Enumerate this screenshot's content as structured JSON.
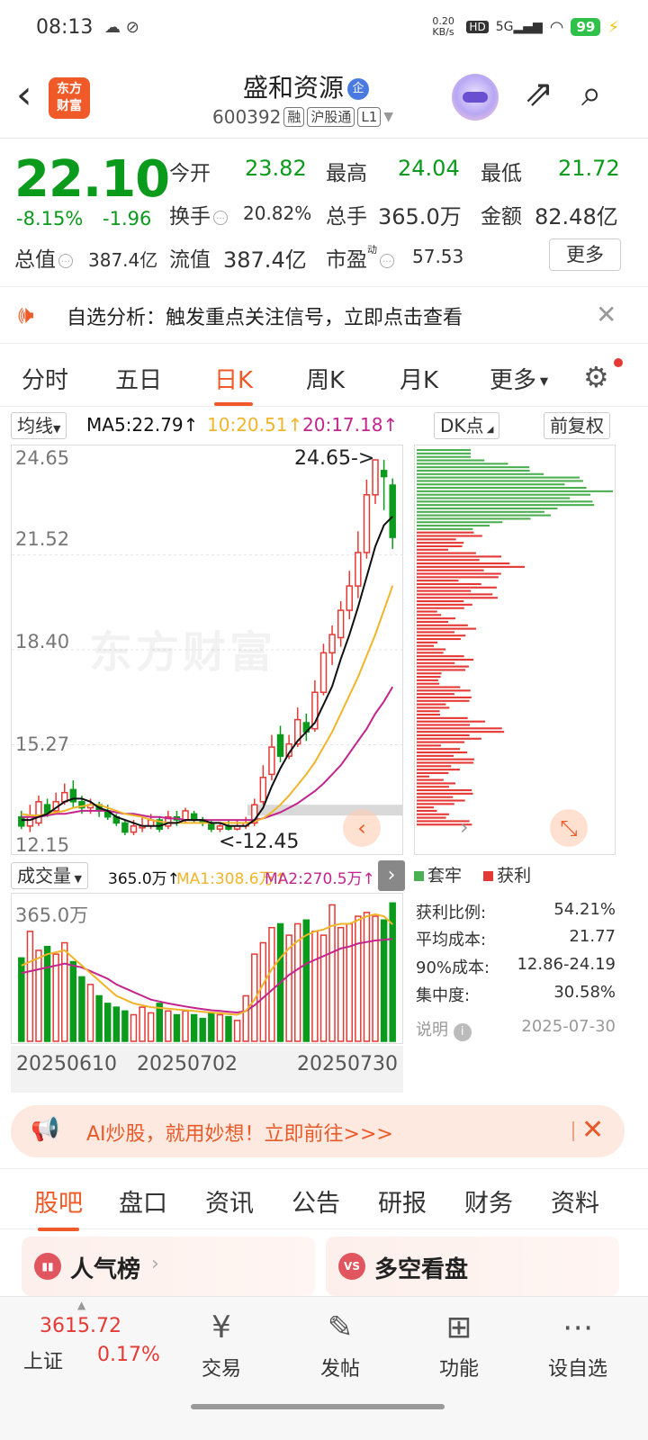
{
  "status_bar": {
    "time": "08:13",
    "net_speed": "0.20 KB/s",
    "net_type": "5G",
    "battery": "99"
  },
  "header": {
    "stock_name": "盛和资源",
    "enterprise_badge": "企",
    "code": "600392",
    "tags": [
      "融",
      "沪股通",
      "L1"
    ],
    "logo_text": "东方财富"
  },
  "quote": {
    "price": "22.10",
    "change_pct": "-8.15%",
    "change_abs": "-1.96",
    "open_label": "今开",
    "open": "23.82",
    "high_label": "最高",
    "high": "24.04",
    "low_label": "最低",
    "low": "21.72",
    "turnover_label": "换手",
    "turnover": "20.82%",
    "volume_label": "总手",
    "volume": "365.0万",
    "amount_label": "金额",
    "amount": "82.48亿",
    "total_mv_label": "总值",
    "total_mv": "387.4亿",
    "float_mv_label": "流值",
    "float_mv": "387.4亿",
    "pe_label": "市盈",
    "pe_sup": "动",
    "pe": "57.53",
    "more_button": "更多"
  },
  "alert": {
    "text": "自选分析：触发重点关注信号，立即点击查看"
  },
  "period_tabs": [
    "分时",
    "五日",
    "日K",
    "周K",
    "月K",
    "更多"
  ],
  "active_period": "日K",
  "ma_bar": {
    "dropdown": "均线",
    "ma5": "MA5:22.79",
    "ma10": "10:20.51",
    "ma20": "20:17.18",
    "dk_button": "DK点",
    "adjust_button": "前复权"
  },
  "kline": {
    "y_ticks": [
      "24.65",
      "21.52",
      "18.40",
      "15.27",
      "12.15"
    ],
    "high_marker": "24.65->",
    "low_marker": "<-12.45",
    "watermark": "东方财富"
  },
  "volume": {
    "dropdown": "成交量",
    "vol": "365.0万",
    "ma1": "MA1:308.6万",
    "ma2": "MA2:270.5万",
    "max_label": "365.0万",
    "x_labels": [
      "20250610",
      "20250702",
      "20250730"
    ]
  },
  "dk_panel": {
    "legend_trapped": "套牢",
    "legend_profit": "获利",
    "stats": [
      {
        "label": "获利比例:",
        "value": "54.21%"
      },
      {
        "label": "平均成本:",
        "value": "21.77"
      },
      {
        "label": "90%成本:",
        "value": "12.86-24.19"
      },
      {
        "label": "集中度:",
        "value": "30.58%"
      }
    ],
    "note_label": "说明",
    "date": "2025-07-30"
  },
  "promo": {
    "text": "AI炒股，就用妙想！立即前往>>>"
  },
  "content_tabs": [
    "股吧",
    "盘口",
    "资讯",
    "公告",
    "研报",
    "财务",
    "资料"
  ],
  "active_content_tab": "股吧",
  "cards": [
    {
      "icon": "bar-chart-icon",
      "title": "人气榜"
    },
    {
      "icon": "vs-icon",
      "title": "多空看盘"
    }
  ],
  "bottom_nav": {
    "index_value": "3615.72",
    "index_name": "上证",
    "index_pct": "0.17%",
    "items": [
      "交易",
      "发帖",
      "功能",
      "设自选"
    ]
  },
  "colors": {
    "up": "#e53935",
    "down": "#0a9a1c",
    "accent": "#f05a28",
    "ma5": "#111111",
    "ma10": "#f0b52a",
    "ma20": "#c2258d"
  },
  "chart_data": {
    "type": "candlestick",
    "ylim": [
      12.15,
      24.65
    ],
    "candles": [
      [
        12.9,
        12.6,
        13.1,
        12.5
      ],
      [
        12.6,
        12.9,
        13.3,
        12.4
      ],
      [
        12.7,
        13.4,
        13.6,
        12.6
      ],
      [
        13.3,
        13.0,
        13.5,
        12.9
      ],
      [
        13.1,
        13.4,
        13.7,
        13.0
      ],
      [
        13.4,
        13.7,
        14.0,
        13.3
      ],
      [
        13.8,
        13.4,
        14.1,
        13.2
      ],
      [
        13.4,
        13.2,
        13.6,
        13.0
      ],
      [
        13.2,
        13.3,
        13.5,
        13.0
      ],
      [
        13.3,
        13.1,
        13.4,
        12.9
      ],
      [
        13.1,
        12.9,
        13.3,
        12.8
      ],
      [
        12.9,
        12.7,
        13.0,
        12.6
      ],
      [
        12.7,
        12.4,
        12.8,
        12.3
      ],
      [
        12.4,
        12.6,
        12.8,
        12.3
      ],
      [
        12.6,
        12.6,
        12.9,
        12.4
      ],
      [
        12.6,
        12.8,
        13.0,
        12.5
      ],
      [
        12.8,
        12.5,
        12.9,
        12.4
      ],
      [
        12.6,
        12.9,
        13.1,
        12.5
      ],
      [
        12.9,
        12.8,
        13.1,
        12.6
      ],
      [
        12.8,
        13.1,
        13.2,
        12.7
      ],
      [
        13.0,
        12.8,
        13.1,
        12.7
      ],
      [
        12.8,
        12.7,
        12.9,
        12.6
      ],
      [
        12.7,
        12.5,
        12.8,
        12.4
      ],
      [
        12.5,
        12.6,
        12.7,
        12.4
      ],
      [
        12.6,
        12.5,
        12.8,
        12.45
      ],
      [
        12.5,
        12.6,
        12.8,
        12.45
      ],
      [
        12.6,
        12.7,
        12.9,
        12.5
      ],
      [
        12.7,
        13.3,
        13.5,
        12.6
      ],
      [
        13.4,
        14.2,
        14.6,
        13.3
      ],
      [
        14.3,
        15.2,
        15.6,
        14.1
      ],
      [
        15.6,
        14.9,
        15.9,
        14.7
      ],
      [
        14.9,
        15.3,
        15.6,
        14.8
      ],
      [
        15.3,
        16.1,
        16.5,
        15.2
      ],
      [
        16.0,
        15.7,
        16.3,
        15.4
      ],
      [
        15.8,
        17.0,
        17.4,
        15.7
      ],
      [
        17.0,
        18.3,
        18.6,
        16.9
      ],
      [
        18.3,
        18.9,
        19.2,
        17.9
      ],
      [
        18.8,
        19.7,
        20.0,
        18.5
      ],
      [
        19.7,
        20.5,
        21.0,
        19.4
      ],
      [
        20.5,
        21.6,
        22.3,
        20.1
      ],
      [
        21.6,
        23.5,
        24.0,
        21.4
      ],
      [
        23.5,
        24.65,
        24.65,
        23.2
      ],
      [
        24.3,
        24.1,
        24.65,
        23.0
      ],
      [
        23.82,
        22.1,
        24.04,
        21.72
      ]
    ],
    "ma5": [
      12.8,
      12.8,
      12.9,
      13.0,
      13.2,
      13.4,
      13.5,
      13.5,
      13.4,
      13.2,
      13.1,
      12.9,
      12.8,
      12.7,
      12.6,
      12.6,
      12.6,
      12.7,
      12.7,
      12.8,
      12.8,
      12.8,
      12.7,
      12.7,
      12.6,
      12.6,
      12.6,
      12.8,
      13.2,
      13.9,
      14.5,
      15.0,
      15.4,
      15.7,
      16.0,
      16.6,
      17.2,
      18.1,
      18.9,
      19.8,
      20.8,
      21.8,
      22.5,
      22.79
    ],
    "ma10": [
      13.0,
      12.95,
      12.95,
      13.0,
      13.05,
      13.1,
      13.2,
      13.25,
      13.3,
      13.3,
      13.2,
      13.1,
      13.0,
      12.95,
      12.9,
      12.8,
      12.75,
      12.7,
      12.7,
      12.7,
      12.7,
      12.7,
      12.7,
      12.7,
      12.7,
      12.7,
      12.7,
      12.75,
      12.85,
      13.05,
      13.3,
      13.6,
      13.95,
      14.3,
      14.7,
      15.2,
      15.7,
      16.3,
      16.9,
      17.5,
      18.2,
      18.9,
      19.7,
      20.51
    ],
    "ma20": [
      12.9,
      12.9,
      12.9,
      12.95,
      13.0,
      13.0,
      13.05,
      13.1,
      13.1,
      13.1,
      13.1,
      13.05,
      13.0,
      13.0,
      12.95,
      12.9,
      12.9,
      12.85,
      12.85,
      12.8,
      12.8,
      12.8,
      12.8,
      12.8,
      12.8,
      12.8,
      12.8,
      12.8,
      12.85,
      12.95,
      13.05,
      13.2,
      13.35,
      13.55,
      13.75,
      14.0,
      14.3,
      14.6,
      15.0,
      15.4,
      15.8,
      16.3,
      16.7,
      17.18
    ],
    "volume": [
      220,
      290,
      240,
      250,
      230,
      260,
      210,
      170,
      150,
      120,
      100,
      90,
      80,
      70,
      90,
      75,
      100,
      80,
      70,
      80,
      70,
      60,
      75,
      70,
      65,
      55,
      120,
      230,
      260,
      300,
      310,
      280,
      310,
      320,
      290,
      280,
      360,
      300,
      310,
      330,
      340,
      330,
      320,
      365
    ],
    "vol_ma1": [
      200,
      210,
      220,
      230,
      235,
      240,
      220,
      200,
      180,
      160,
      140,
      120,
      110,
      100,
      95,
      90,
      88,
      86,
      84,
      82,
      80,
      78,
      76,
      74,
      72,
      70,
      80,
      110,
      150,
      190,
      220,
      245,
      265,
      280,
      290,
      295,
      305,
      310,
      310,
      320,
      330,
      335,
      330,
      308.6
    ],
    "vol_ma2": [
      180,
      185,
      190,
      195,
      200,
      205,
      200,
      195,
      185,
      175,
      165,
      150,
      140,
      130,
      120,
      110,
      105,
      100,
      96,
      92,
      88,
      85,
      82,
      80,
      78,
      76,
      80,
      95,
      115,
      135,
      155,
      175,
      190,
      205,
      215,
      225,
      235,
      245,
      250,
      258,
      262,
      266,
      268,
      270.5
    ],
    "chip_distribution": {
      "profit_ratio": 54.21,
      "avg_cost": 21.77,
      "cost_90": [
        12.86,
        24.19
      ],
      "concentration": 30.58
    }
  }
}
